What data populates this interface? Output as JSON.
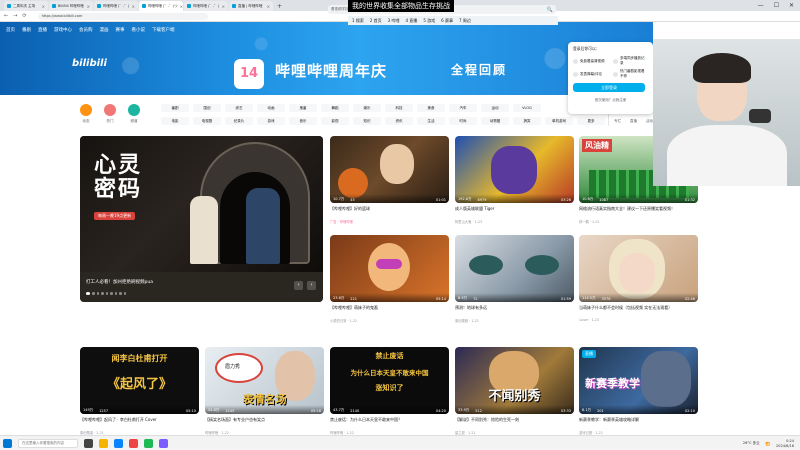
{
  "overlay_text": "我的世界收集全部物品生存挑战",
  "browser": {
    "tabs": [
      {
        "label": "二周年庆 主场"
      },
      {
        "label": "BiliBili 哔哩哔哩"
      },
      {
        "label": "哔哩哔哩 (゜-゜)"
      },
      {
        "label": "哔哩哔哩 (゜-゜)つ"
      },
      {
        "label": "哔哩哔哩 (゜-゜)"
      },
      {
        "label": "直播 | 哔哩哔哩"
      }
    ],
    "new_tab": "+",
    "url": "https://www.bilibili.com",
    "nav_back": "←",
    "nav_forward": "→",
    "nav_reload": "⟳",
    "window_min": "—",
    "window_max": "☐",
    "window_close": "✕"
  },
  "topnav": [
    "首页",
    "番剧",
    "直播",
    "游戏中心",
    "会员购",
    "漫画",
    "赛事",
    "看小说",
    "下载客户端"
  ],
  "search": {
    "placeholder": "看视频学技术",
    "icon": "🔍"
  },
  "hotlist": [
    "1 搜索",
    "2 首页",
    "3 哔哩",
    "4 直播",
    "5 游戏",
    "6 赛事",
    "7 周边"
  ],
  "banner": {
    "logo": "bilibili",
    "anniv_badge": "14",
    "anniv_title": "哔哩哔哩周年庆",
    "anniv_sub": "全程回顾"
  },
  "login_popover": {
    "title": "登录后你可以：",
    "items": [
      "免费看高清视频",
      "多端同步播放记录",
      "发表弹幕/评论",
      "热门番剧影视看不停"
    ],
    "login_button": "立即登录",
    "register": "首次使用？点我注册"
  },
  "categories": [
    {
      "label": "动态",
      "color": "#ff9212"
    },
    {
      "label": "热门",
      "color": "#f07775"
    },
    {
      "label": "频道",
      "color": "#1bb5a0"
    }
  ],
  "chips_row1": [
    "番剧",
    "国创",
    "综艺",
    "动画",
    "鬼畜",
    "舞蹈",
    "娱乐",
    "科技",
    "美食",
    "汽车",
    "运动",
    "VLOG"
  ],
  "chips_row2": [
    "电影",
    "电视剧",
    "纪录片",
    "游戏",
    "音乐",
    "影视",
    "知识",
    "资讯",
    "生活",
    "时尚",
    "动物圈",
    "搞笑",
    "单机游戏",
    "更多"
  ],
  "extras": [
    "专栏",
    "直播",
    "活动",
    "课堂",
    "社区中心"
  ],
  "carousel": {
    "title_line1": "心灵",
    "title_line2": "密码",
    "tag": "每周一晚19点更新",
    "caption": "打工人必看！加州拒绝刷视频pua",
    "prev": "‹",
    "next": "›"
  },
  "cards": [
    {
      "title": "【哔哩哔哩】好的篮球",
      "plays": "10.7万",
      "danmaku": "45",
      "duration": "01:01",
      "meta": "广告 · 哔哩哔哩",
      "ad": true
    },
    {
      "title": "成人版英雄联盟 Tiger",
      "plays": "192.8万",
      "danmaku": "8979",
      "duration": "03:26",
      "meta": "阿里山大鬼 · 1-23",
      "ad": false
    },
    {
      "title": "网络流行语真实指南大全！建议一下还原爆笑看视频！",
      "plays": "10.6万",
      "danmaku": "1087",
      "duration": "01:32",
      "meta": "林一鹏 · 1-22",
      "ad": false
    },
    {
      "title": "【哔哩哔哩】萌妹子的鬼畜",
      "plays": "23.6万",
      "danmaku": "221",
      "duration": "05:14",
      "meta": "小梁的日常 · 1-22",
      "ad": false
    },
    {
      "title": "预测！地球有多远",
      "plays": "8.9万",
      "danmaku": "72",
      "duration": "01:59",
      "meta": "原创视频 · 1-21",
      "ad": false
    },
    {
      "title": "当萌妹子什么都不会时候（包括视频 实在无法观看）",
      "plays": "114.5万",
      "danmaku": "3576",
      "duration": "02:46",
      "meta": "Coser · 1-23",
      "ad": false
    },
    {
      "title": "【哔哩哔哩】起风了 · 李白杜甫打开 Cover",
      "plays": "149万",
      "danmaku": "1257",
      "duration": "05:10",
      "meta": "原创歌曲 · 1-21",
      "ad": false
    },
    {
      "title": "【搞笑名场面】有专业户也有笑点",
      "plays": "24.8万",
      "danmaku": "1243",
      "duration": "05:18",
      "meta": "哔哩哔哩 · 1-22",
      "ad": false
    },
    {
      "title": "禁止废话：为什么日本天皇不敢来中国？",
      "plays": "43.7万",
      "danmaku": "2140",
      "duration": "04:20",
      "meta": "哔哩哔哩 · 1-22",
      "ad": false
    },
    {
      "title": "【解说】不同别秀：惊险的生死一刻",
      "plays": "33.9万",
      "danmaku": "512",
      "duration": "03:33",
      "meta": "星之夏 · 1-21",
      "ad": false
    },
    {
      "title": "新赛季教学：新赛季英雄攻略详解",
      "plays": "8.1万",
      "danmaku": "201",
      "duration": "02:10",
      "meta": "游戏日报 · 1-22",
      "ad": false
    }
  ],
  "thumb_text": {
    "card7_top": "闻李白杜甫打开",
    "card7_bottom": "《起风了》",
    "card8_label": "眉力秀",
    "card8_bottom": "表情名场",
    "card9_top": "禁止废话",
    "card9_mid": "为什么日本天皇不敢来中国",
    "card9_bottom": "涨知识了",
    "card10_text": "不闻别秀",
    "card11_tag": "直播",
    "card11_text": "新赛季教学"
  },
  "taskbar": {
    "search_placeholder": "在这里输入你要搜索的内容",
    "weather": "26°C 多云",
    "time": "0:24",
    "date": "2024/6/16"
  }
}
